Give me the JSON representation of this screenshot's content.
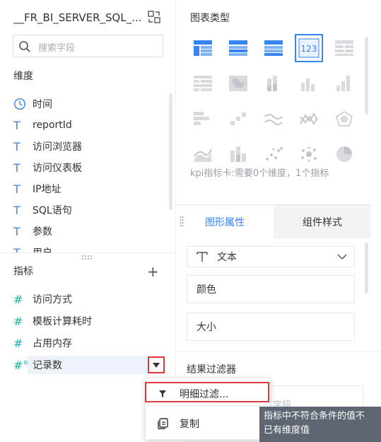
{
  "left_panel": {
    "dataset_title": "__FR_BI_SERVER_SQL_...",
    "search_placeholder": "搜索字段",
    "dimensions_label": "维度",
    "dimensions": [
      {
        "label": "时间",
        "icon": "clock-icon"
      },
      {
        "label": "reportId",
        "icon": "text-field-icon"
      },
      {
        "label": "访问浏览器",
        "icon": "text-field-icon"
      },
      {
        "label": "访问仪表板",
        "icon": "text-field-icon"
      },
      {
        "label": "IP地址",
        "icon": "text-field-icon"
      },
      {
        "label": "SQL语句",
        "icon": "text-field-icon"
      },
      {
        "label": "参数",
        "icon": "text-field-icon"
      },
      {
        "label": "用户",
        "icon": "text-field-icon"
      }
    ],
    "metrics_label": "指标",
    "metrics": [
      {
        "label": "访问方式",
        "icon_text": "#"
      },
      {
        "label": "模板计算耗时",
        "icon_text": "#"
      },
      {
        "label": "占用内存",
        "icon_text": "#"
      },
      {
        "label": "记录数",
        "icon_text": "#°"
      }
    ]
  },
  "context_menu": {
    "items": [
      {
        "label": "明细过滤...",
        "icon": "filter-icon"
      },
      {
        "label": "复制",
        "icon": "copy-icon"
      }
    ]
  },
  "right_panel": {
    "chart_type_title": "图表类型",
    "selected_chart_label": "123",
    "kpi_hint": "kpi指标卡:需要0个维度，1个指标",
    "tabs": [
      {
        "label": "图形属性",
        "active": true
      },
      {
        "label": "组件样式",
        "active": false
      }
    ],
    "mark_type": "文本",
    "properties": [
      "颜色",
      "大小"
    ],
    "result_filter_title": "结果过滤器",
    "filter_placeholder": "入字段"
  },
  "tooltip": {
    "line1": "指标中不符合条件的值不",
    "line2": "已有维度值"
  },
  "colors": {
    "accent": "#3685f2",
    "highlight_box": "#e0393e",
    "dimension_icon": "#4a8ad6",
    "metric_icon": "#1db4a6"
  }
}
